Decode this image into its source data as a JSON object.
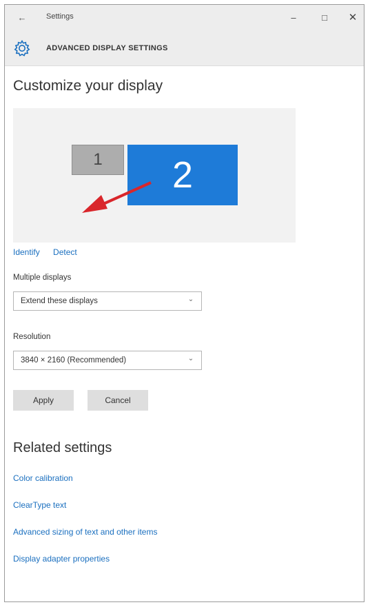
{
  "titlebar": {
    "title": "Settings",
    "back_glyph": "←",
    "minimize_glyph": "–",
    "maximize_glyph": "□",
    "close_glyph": "✕"
  },
  "header": {
    "icon": "gear-icon",
    "title": "ADVANCED DISPLAY SETTINGS"
  },
  "page": {
    "title": "Customize your display"
  },
  "displays": {
    "monitor_1_label": "1",
    "monitor_2_label": "2",
    "selected_color": "#1e7bd8",
    "unselected_color": "#adadad",
    "arrow_color": "#d9262b"
  },
  "links": {
    "identify": "Identify",
    "detect": "Detect"
  },
  "multiple_displays": {
    "label": "Multiple displays",
    "value": "Extend these displays"
  },
  "resolution": {
    "label": "Resolution",
    "value": "3840 × 2160 (Recommended)"
  },
  "buttons": {
    "apply": "Apply",
    "cancel": "Cancel"
  },
  "related": {
    "title": "Related settings",
    "items": [
      "Color calibration",
      "ClearType text",
      "Advanced sizing of text and other items",
      "Display adapter properties"
    ]
  },
  "colors": {
    "accent_link": "#1a6fbf",
    "chrome_bg": "#ededed"
  }
}
